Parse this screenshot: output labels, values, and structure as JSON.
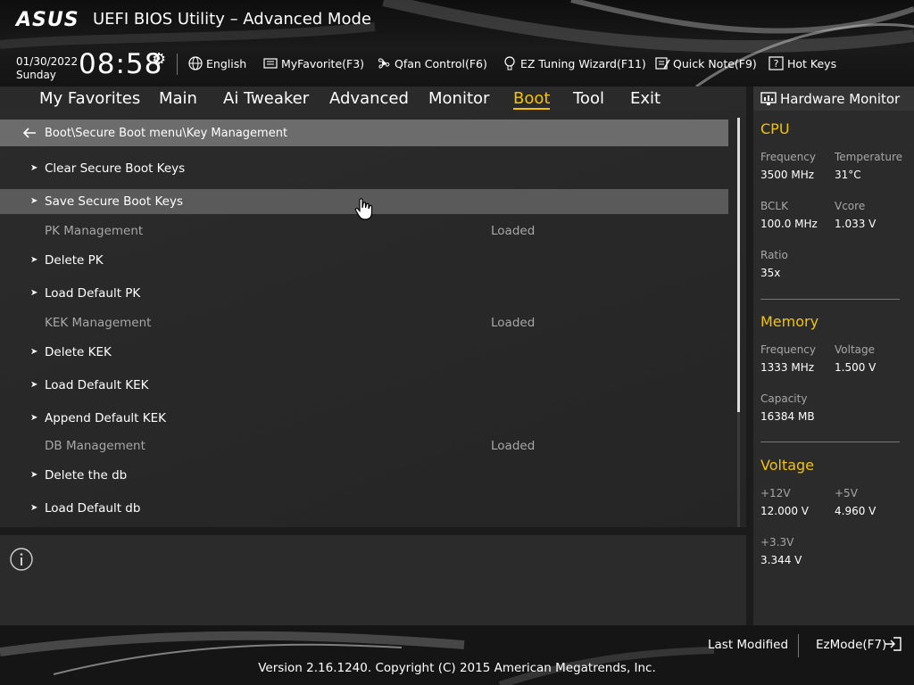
{
  "header": {
    "logo": "ASUS",
    "title": "UEFI BIOS Utility – Advanced Mode",
    "date": "01/30/2022",
    "day": "Sunday",
    "time": "08:58",
    "buttons": [
      {
        "label": "English",
        "icon": "globe-icon"
      },
      {
        "label": "MyFavorite(F3)",
        "icon": "favorite-icon"
      },
      {
        "label": "Qfan Control(F6)",
        "icon": "fan-icon"
      },
      {
        "label": "EZ Tuning Wizard(F11)",
        "icon": "bulb-icon"
      },
      {
        "label": "Quick Note(F9)",
        "icon": "note-icon"
      },
      {
        "label": "Hot Keys",
        "icon": "help-icon"
      }
    ]
  },
  "nav": {
    "tabs": [
      "My Favorites",
      "Main",
      "Ai Tweaker",
      "Advanced",
      "Monitor",
      "Boot",
      "Tool",
      "Exit"
    ],
    "active": "Boot"
  },
  "main": {
    "breadcrumb": "Boot\\Secure Boot menu\\Key Management",
    "rows": [
      {
        "label": "Clear Secure Boot Keys",
        "type": "action"
      },
      {
        "label": "Save Secure Boot Keys",
        "type": "action",
        "highlighted": true
      },
      {
        "label": "PK Management",
        "type": "static",
        "value": "Loaded"
      },
      {
        "label": "Delete PK",
        "type": "action"
      },
      {
        "label": "Load Default PK",
        "type": "action"
      },
      {
        "label": "KEK Management",
        "type": "static",
        "value": "Loaded"
      },
      {
        "label": "Delete KEK",
        "type": "action"
      },
      {
        "label": "Load Default KEK",
        "type": "action"
      },
      {
        "label": "Append Default KEK",
        "type": "action"
      },
      {
        "label": "DB Management",
        "type": "static",
        "value": "Loaded"
      },
      {
        "label": "Delete the db",
        "type": "action"
      },
      {
        "label": "Load Default db",
        "type": "action"
      }
    ]
  },
  "hw_monitor": {
    "title": "Hardware Monitor",
    "cpu": {
      "title": "CPU",
      "frequency_label": "Frequency",
      "frequency": "3500 MHz",
      "temperature_label": "Temperature",
      "temperature": "31°C",
      "bclk_label": "BCLK",
      "bclk": "100.0 MHz",
      "vcore_label": "Vcore",
      "vcore": "1.033 V",
      "ratio_label": "Ratio",
      "ratio": "35x"
    },
    "memory": {
      "title": "Memory",
      "frequency_label": "Frequency",
      "frequency": "1333 MHz",
      "voltage_label": "Voltage",
      "voltage": "1.500 V",
      "capacity_label": "Capacity",
      "capacity": "16384 MB"
    },
    "voltage": {
      "title": "Voltage",
      "v12_label": "+12V",
      "v12": "12.000 V",
      "v5_label": "+5V",
      "v5": "4.960 V",
      "v33_label": "+3.3V",
      "v33": "3.344 V"
    }
  },
  "footer": {
    "last_modified": "Last Modified",
    "ezmode": "EzMode(F7)",
    "version": "Version 2.16.1240. Copyright (C) 2015 American Megatrends, Inc."
  },
  "colors": {
    "accent": "#f5c400",
    "divider": "#5a7f88",
    "highlight_row": "#5a5a5a",
    "breadcrumb_bar": "#6c6c6c"
  }
}
